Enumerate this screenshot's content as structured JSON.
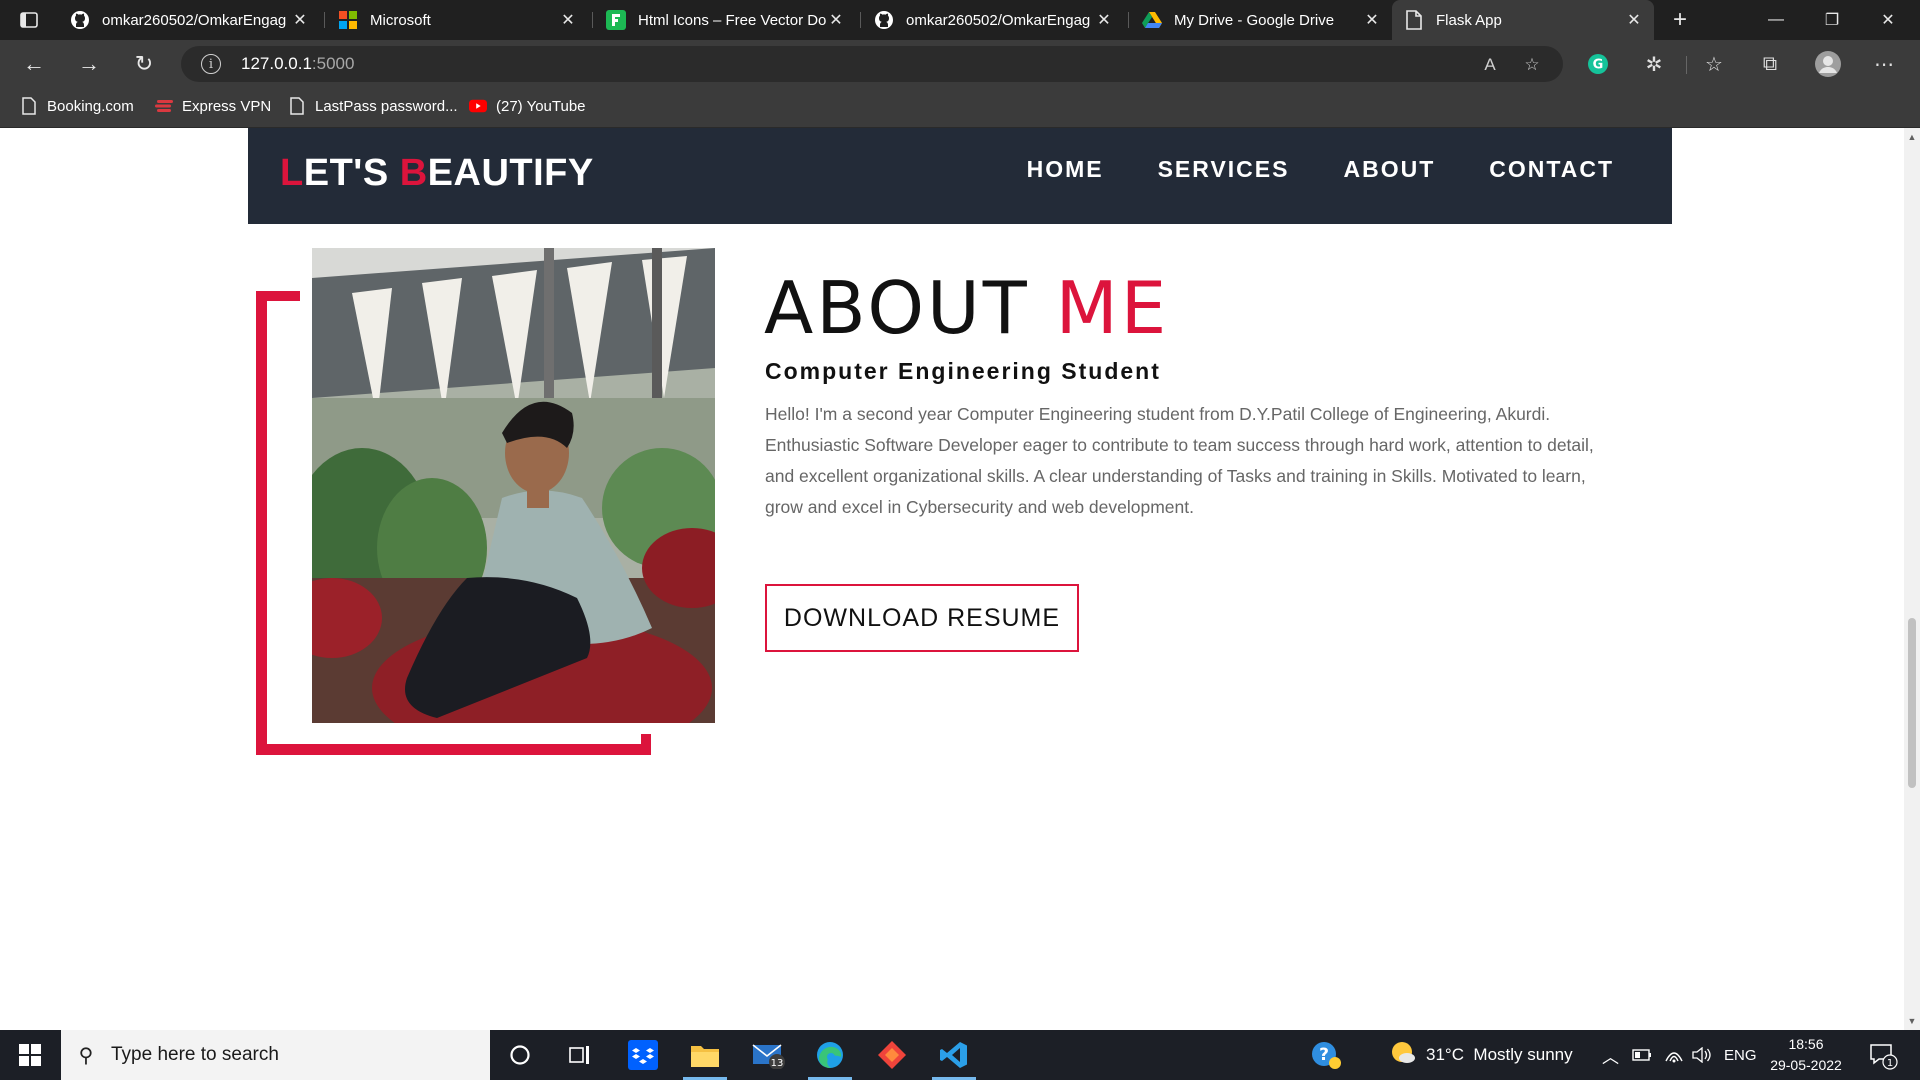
{
  "browser": {
    "tabs": [
      {
        "title": "omkar260502/OmkarEngag",
        "icon": "github-icon"
      },
      {
        "title": "Microsoft",
        "icon": "microsoft-icon"
      },
      {
        "title": "Html Icons – Free Vector Do",
        "icon": "freepik-icon"
      },
      {
        "title": "omkar260502/OmkarEngag",
        "icon": "github-icon"
      },
      {
        "title": "My Drive - Google Drive",
        "icon": "google-drive-icon"
      },
      {
        "title": "Flask App",
        "icon": "page-icon"
      }
    ],
    "url_host": "127.0.0.1",
    "url_port": ":5000",
    "read_aloud_label": "A",
    "bookmarks": [
      {
        "label": "Booking.com",
        "icon": "page-icon"
      },
      {
        "label": "Express VPN",
        "icon": "expressvpn-icon"
      },
      {
        "label": "LastPass password...",
        "icon": "page-icon"
      },
      {
        "label": "(27) YouTube",
        "icon": "youtube-icon"
      }
    ]
  },
  "site": {
    "logo": {
      "l1": "L",
      "rest1": "ET'S ",
      "b1": "B",
      "rest2": "EAUTIFY"
    },
    "nav": [
      "HOME",
      "SERVICES",
      "ABOUT",
      "CONTACT"
    ],
    "about": {
      "heading_main": "ABOUT ",
      "heading_accent": "ME",
      "subtitle": "Computer Engineering Student",
      "paragraph": "Hello! I'm a second year Computer Engineering student from D.Y.Patil College of Engineering, Akurdi. Enthusiastic Software Developer eager to contribute to team success through hard work, attention to detail, and excellent organizational skills. A clear understanding of Tasks and training in Skills. Motivated to learn, grow and excel in Cybersecurity and web development.",
      "button": "DOWNLOAD RESUME"
    },
    "colors": {
      "accent": "#dc143c",
      "nav_bg": "#232b38"
    }
  },
  "taskbar": {
    "search_placeholder": "Type here to search",
    "mail_badge": "13",
    "weather": "31°C  Mostly sunny",
    "language": "ENG",
    "time": "18:56",
    "date": "29-05-2022",
    "notification_count": "1"
  }
}
